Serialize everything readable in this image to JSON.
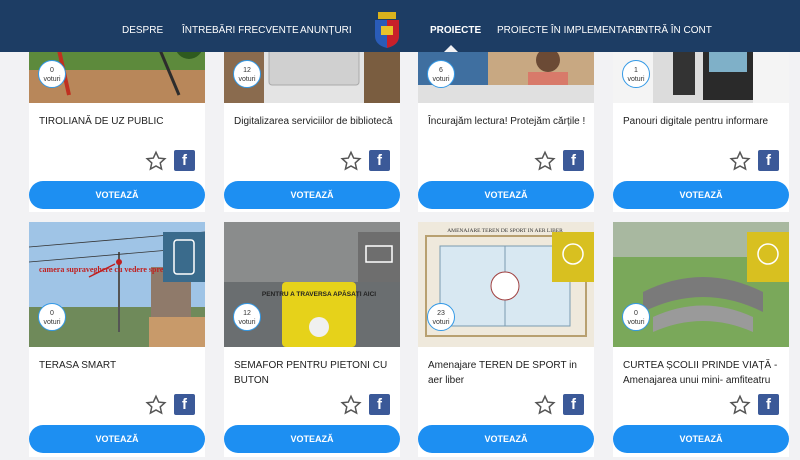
{
  "nav": {
    "items": [
      {
        "label": "Despre"
      },
      {
        "label": "Întrebări frecvente"
      },
      {
        "label": "Anunțuri"
      },
      {
        "label": "Proiecte"
      },
      {
        "label": "Proiecte în implementare"
      },
      {
        "label": "Intră în cont"
      }
    ],
    "active": "Proiecte"
  },
  "vote_button_label": "VOTEAZĂ",
  "cards": [
    {
      "title": "TIROLIANĂ DE UZ PUBLIC",
      "votes": "0",
      "votes_unit": "voturi"
    },
    {
      "title": "Digitalizarea serviciilor de bibliotecă",
      "votes": "12",
      "votes_unit": "voturi"
    },
    {
      "title": "Încurajăm lectura! Protejăm cărțile !",
      "votes": "6",
      "votes_unit": "voturi"
    },
    {
      "title": "Panouri digitale pentru informare",
      "votes": "1",
      "votes_unit": "voturi"
    },
    {
      "title": "TERASA SMART",
      "votes": "0",
      "votes_unit": "voturi",
      "image_text": "camera supraveghere cu vedere spre terasa"
    },
    {
      "title": "SEMAFOR PENTRU PIETONI CU BUTON",
      "votes": "12",
      "votes_unit": "voturi",
      "image_text": "PENTRU A TRAVERSA APĂSAȚI AICI"
    },
    {
      "title": "Amenajare TEREN DE SPORT in aer liber",
      "votes": "23",
      "votes_unit": "voturi",
      "image_text": "AMENAJARE TEREN DE SPORT IN AER LIBER"
    },
    {
      "title": "CURTEA ȘCOLII PRINDE VIAȚĂ - Amenajarea unui mini- amfiteatru",
      "votes": "0",
      "votes_unit": "voturi"
    }
  ],
  "colors": {
    "nav_bg": "#1d3d64",
    "button": "#1d8ff2",
    "facebook": "#3b5998",
    "badge_cat1": "#3a6b8c",
    "badge_cat2": "#d8c020"
  }
}
